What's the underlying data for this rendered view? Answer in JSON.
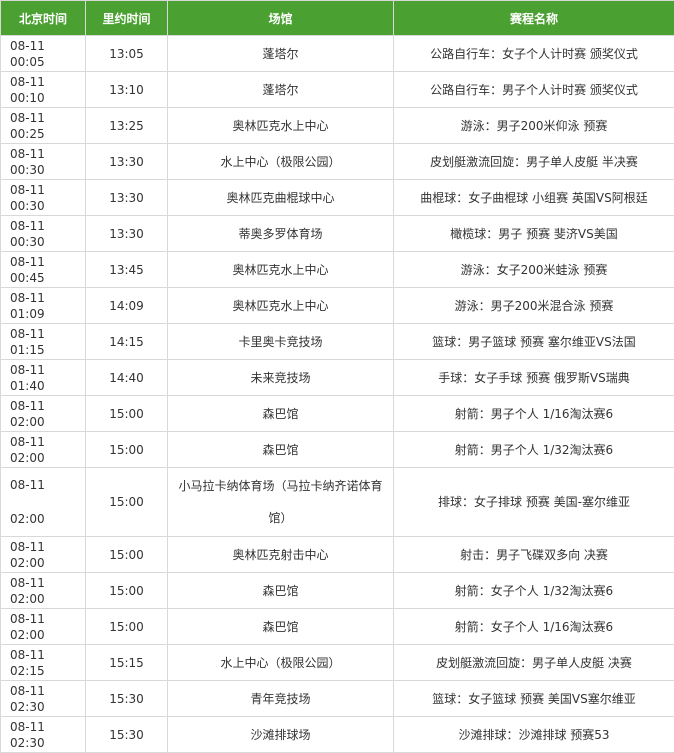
{
  "header": {
    "beijing_time": "北京时间",
    "rio_time": "里约时间",
    "venue": "场馆",
    "event_name": "赛程名称"
  },
  "rows": [
    {
      "beijing": "08-11 00:05",
      "rio": "13:05",
      "venue": "蓬塔尔",
      "event": "公路自行车：女子个人计时赛 颁奖仪式"
    },
    {
      "beijing": "08-11 00:10",
      "rio": "13:10",
      "venue": "蓬塔尔",
      "event": "公路自行车：男子个人计时赛 颁奖仪式"
    },
    {
      "beijing": "08-11 00:25",
      "rio": "13:25",
      "venue": "奥林匹克水上中心",
      "event": "游泳：男子200米仰泳 预赛"
    },
    {
      "beijing": "08-11 00:30",
      "rio": "13:30",
      "venue": "水上中心（极限公园）",
      "event": "皮划艇激流回旋：男子单人皮艇 半决赛"
    },
    {
      "beijing": "08-11 00:30",
      "rio": "13:30",
      "venue": "奥林匹克曲棍球中心",
      "event": "曲棍球：女子曲棍球 小组赛 英国VS阿根廷"
    },
    {
      "beijing": "08-11 00:30",
      "rio": "13:30",
      "venue": "蒂奥多罗体育场",
      "event": "橄榄球：男子 预赛 斐济VS美国"
    },
    {
      "beijing": "08-11 00:45",
      "rio": "13:45",
      "venue": "奥林匹克水上中心",
      "event": "游泳：女子200米蛙泳 预赛"
    },
    {
      "beijing": "08-11 01:09",
      "rio": "14:09",
      "venue": "奥林匹克水上中心",
      "event": "游泳：男子200米混合泳 预赛"
    },
    {
      "beijing": "08-11 01:15",
      "rio": "14:15",
      "venue": "卡里奥卡竞技场",
      "event": "篮球：男子篮球 预赛 塞尔维亚VS法国"
    },
    {
      "beijing": "08-11 01:40",
      "rio": "14:40",
      "venue": "未来竞技场",
      "event": "手球：女子手球 预赛 俄罗斯VS瑞典"
    },
    {
      "beijing": "08-11 02:00",
      "rio": "15:00",
      "venue": "森巴馆",
      "event": "射箭：男子个人 1/16淘汰赛6"
    },
    {
      "beijing": "08-11 02:00",
      "rio": "15:00",
      "venue": "森巴馆",
      "event": "射箭：男子个人 1/32淘汰赛6"
    },
    {
      "beijing": "08-11 02:00",
      "rio": "15:00",
      "venue": "小马拉卡纳体育场（马拉卡纳齐诺体育馆）",
      "event": "排球：女子排球 预赛 美国-塞尔维亚",
      "tall": true
    },
    {
      "beijing": "08-11 02:00",
      "rio": "15:00",
      "venue": "奥林匹克射击中心",
      "event": "射击：男子飞碟双多向 决赛"
    },
    {
      "beijing": "08-11 02:00",
      "rio": "15:00",
      "venue": "森巴馆",
      "event": "射箭：女子个人 1/32淘汰赛6"
    },
    {
      "beijing": "08-11 02:00",
      "rio": "15:00",
      "venue": "森巴馆",
      "event": "射箭：女子个人 1/16淘汰赛6"
    },
    {
      "beijing": "08-11 02:15",
      "rio": "15:15",
      "venue": "水上中心（极限公园）",
      "event": "皮划艇激流回旋：男子单人皮艇 决赛"
    },
    {
      "beijing": "08-11 02:30",
      "rio": "15:30",
      "venue": "青年竞技场",
      "event": "篮球：女子篮球 预赛 美国VS塞尔维亚"
    },
    {
      "beijing": "08-11 02:30",
      "rio": "15:30",
      "venue": "沙滩排球场",
      "event": "沙滩排球：沙滩排球 预赛53"
    }
  ]
}
